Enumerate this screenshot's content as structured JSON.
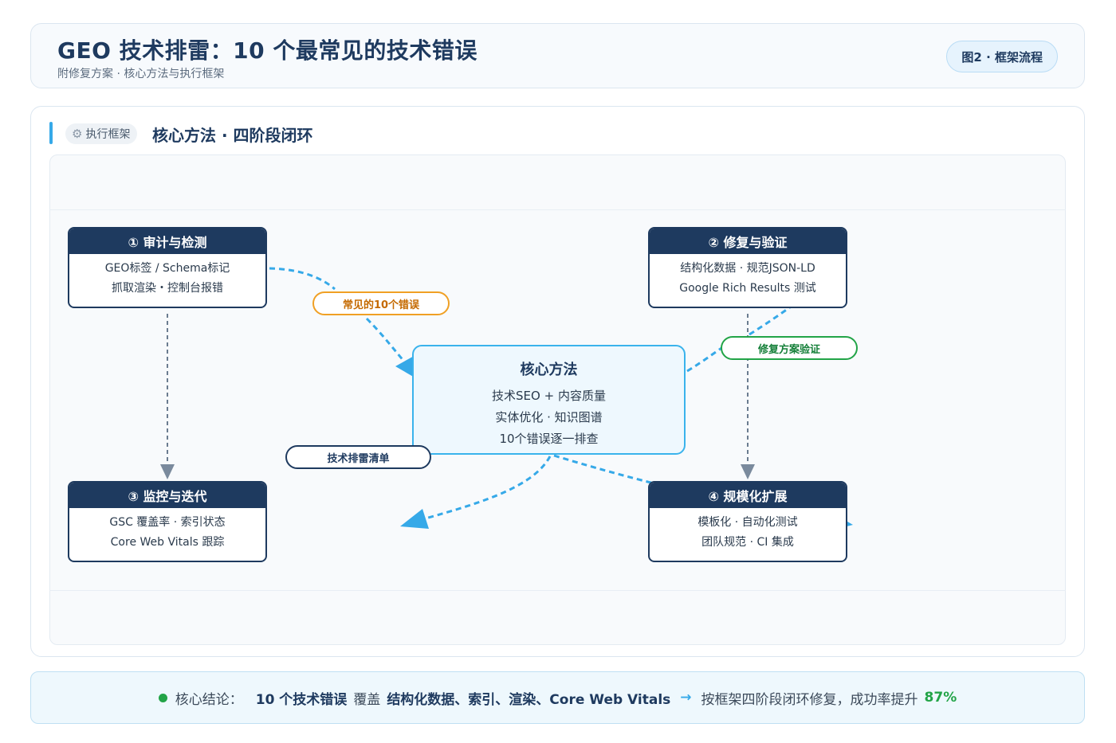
{
  "header": {
    "title": "GEO 技术排雷：10 个最常见的技术错误",
    "subtitle": "附修复方案 · 核心方法与执行框架",
    "badge": "图2 · 框架流程"
  },
  "section": {
    "tag": "执行框架",
    "tag_icon": "gear-icon",
    "title": "核心方法 · 四阶段闭环"
  },
  "nodes": {
    "audit": {
      "title": "① 审计与检测",
      "lines": [
        "GEO标签 / Schema标记",
        "抓取渲染・控制台报错"
      ]
    },
    "fix": {
      "title": "② 修复与验证",
      "lines": [
        "结构化数据 · 规范JSON-LD",
        "Google Rich Results 测试"
      ]
    },
    "monitor": {
      "title": "③ 监控与迭代",
      "lines": [
        "GSC 覆盖率 · 索引状态",
        "Core Web Vitals 跟踪"
      ]
    },
    "scale": {
      "title": "④ 规模化扩展",
      "lines": [
        "模板化 · 自动化测试",
        "团队规范 · CI 集成"
      ]
    }
  },
  "core": {
    "title": "核心方法",
    "lines": [
      "技术SEO + 内容质量",
      "实体优化 · 知识图谱",
      "10个错误逐一排查"
    ]
  },
  "edge_labels": {
    "common_errors": "常见的10个错误",
    "fix_validation": "修复方案验证",
    "checklist": "技术排雷清单"
  },
  "colors": {
    "navy": "#1e3a5f",
    "accent_blue": "#36a9e8",
    "orange": "#f0a024",
    "green": "#22a447"
  },
  "footer": {
    "label": "核心结论：",
    "highlight1": "10 个技术错误",
    "verb": "覆盖",
    "highlight2": "结构化数据、索引、渲染、Core Web Vitals",
    "arrow": "→",
    "conclusion": "按框架四阶段闭环修复，成功率提升",
    "percent": "87%"
  }
}
